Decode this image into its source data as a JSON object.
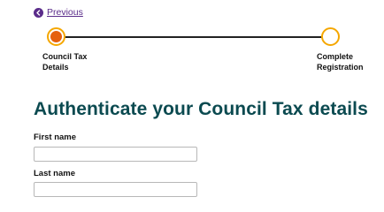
{
  "nav": {
    "previous_label": "Previous"
  },
  "stepper": {
    "steps": [
      {
        "label_line1": "Council Tax",
        "label_line2": "Details",
        "status": "current"
      },
      {
        "label_line1": "Complete",
        "label_line2": "Registration",
        "status": "upcoming"
      }
    ]
  },
  "main": {
    "title": "Authenticate your Council Tax details"
  },
  "form": {
    "first_name": {
      "label": "First name",
      "value": ""
    },
    "last_name": {
      "label": "Last name",
      "value": ""
    }
  },
  "colors": {
    "accent": "#f5a700",
    "active_dot": "#e5600e",
    "link": "#5a2c8a",
    "heading": "#0b4a50"
  }
}
